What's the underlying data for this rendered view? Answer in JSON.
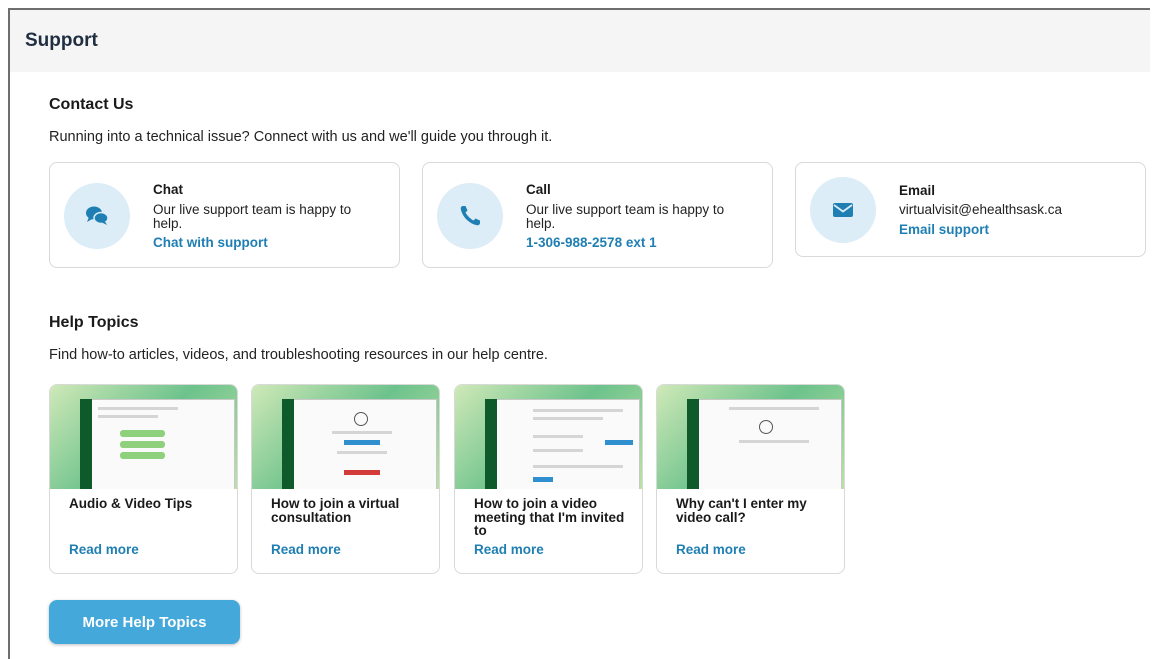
{
  "header": {
    "title": "Support"
  },
  "contact": {
    "title": "Contact Us",
    "description": "Running into a technical issue? Connect with us and we'll guide you through it.",
    "cards": [
      {
        "icon": "chat-bubbles-icon",
        "title": "Chat",
        "text": "Our live support team is happy to help.",
        "link": "Chat with support"
      },
      {
        "icon": "phone-icon",
        "title": "Call",
        "text": "Our live support team is happy to help.",
        "link": "1-306-988-2578 ext 1"
      },
      {
        "icon": "envelope-icon",
        "title": "Email",
        "text": "virtualvisit@ehealthsask.ca",
        "link": "Email support"
      }
    ]
  },
  "help": {
    "title": "Help Topics",
    "description": "Find how-to articles, videos, and troubleshooting resources in our help centre.",
    "cards": [
      {
        "title": "Audio & Video Tips",
        "link": "Read more"
      },
      {
        "title": "How to join a virtual consultation",
        "link": "Read more"
      },
      {
        "title": "How to join a video meeting that I'm invited to",
        "link": "Read more"
      },
      {
        "title": "Why can't I enter my video call?",
        "link": "Read more"
      }
    ],
    "more_button": "More Help Topics"
  },
  "colors": {
    "accent": "#1f7fb3",
    "button": "#45a8db",
    "icon_bg": "#dcedf8",
    "title": "#1f2e40"
  }
}
